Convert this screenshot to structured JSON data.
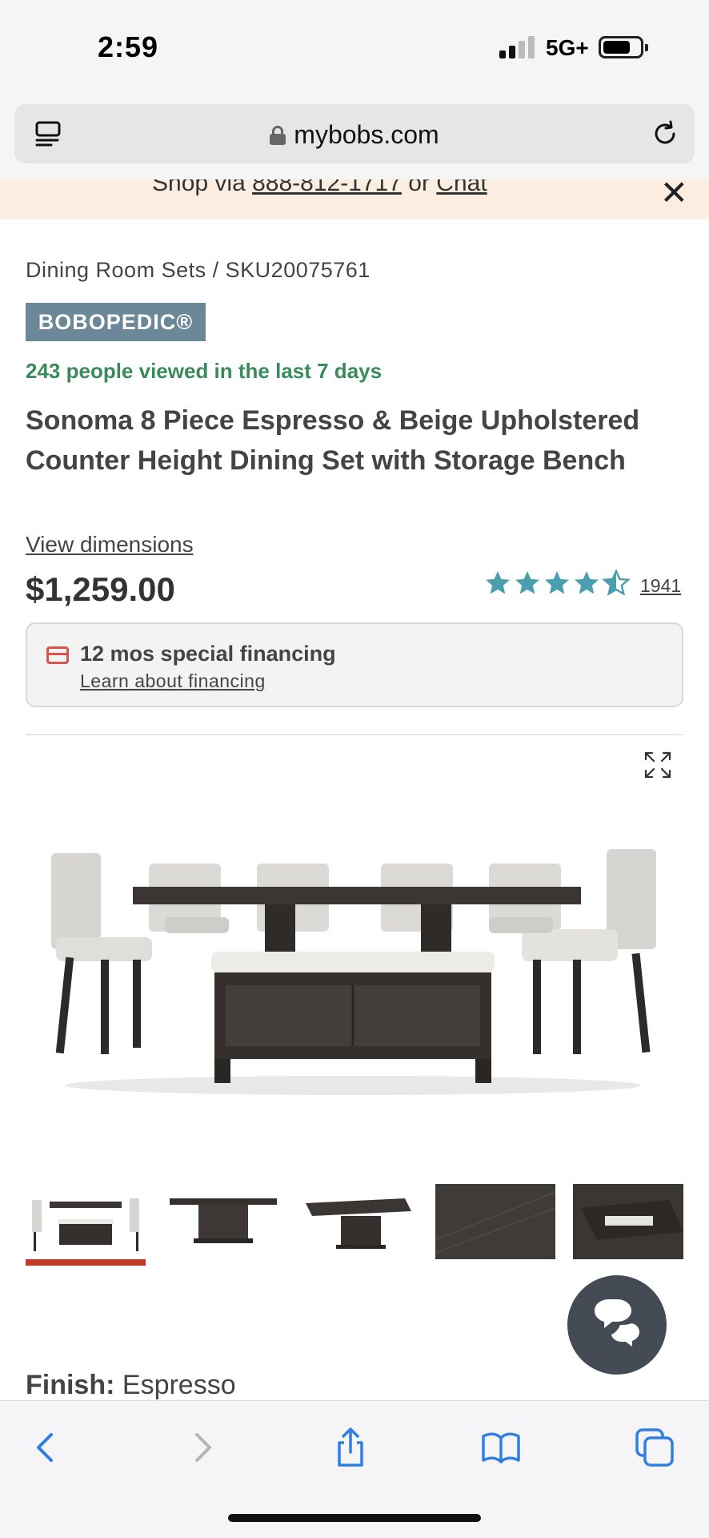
{
  "status": {
    "time": "2:59",
    "network": "5G+"
  },
  "browser": {
    "url": "mybobs.com",
    "reader_icon": "reader-icon",
    "reload_icon": "reload-icon"
  },
  "promo": {
    "prefix": "Shop via ",
    "phone": "888-812-1717",
    "middle": " or ",
    "chat": "Chat"
  },
  "breadcrumb": {
    "category": "Dining Room Sets",
    "separator": "/",
    "sku": "SKU20075761"
  },
  "brand": "BOBOPEDIC®",
  "viewed": "243 people viewed in the last 7 days",
  "product": {
    "title": "Sonoma 8 Piece Espresso & Beige Upholstered Counter Height Dining Set with Storage Bench",
    "view_dimensions": "View dimensions",
    "price": "$1,259.00",
    "rating": 4.5,
    "review_count": "1941"
  },
  "financing": {
    "title": "12 mos special financing",
    "link": "Learn about financing"
  },
  "gallery": {
    "selected_index": 0,
    "thumbnail_count": 5
  },
  "finish": {
    "label": "Finish:",
    "value": "Espresso"
  },
  "colors": {
    "accent_green": "#3a8a5c",
    "accent_red": "#c0392b",
    "star_teal": "#4a9fae",
    "brand_blue": "#6b8899"
  },
  "toolbar": {
    "back_icon": "back-icon",
    "forward_icon": "forward-icon",
    "share_icon": "share-icon",
    "bookmarks_icon": "bookmarks-icon",
    "tabs_icon": "tabs-icon"
  }
}
